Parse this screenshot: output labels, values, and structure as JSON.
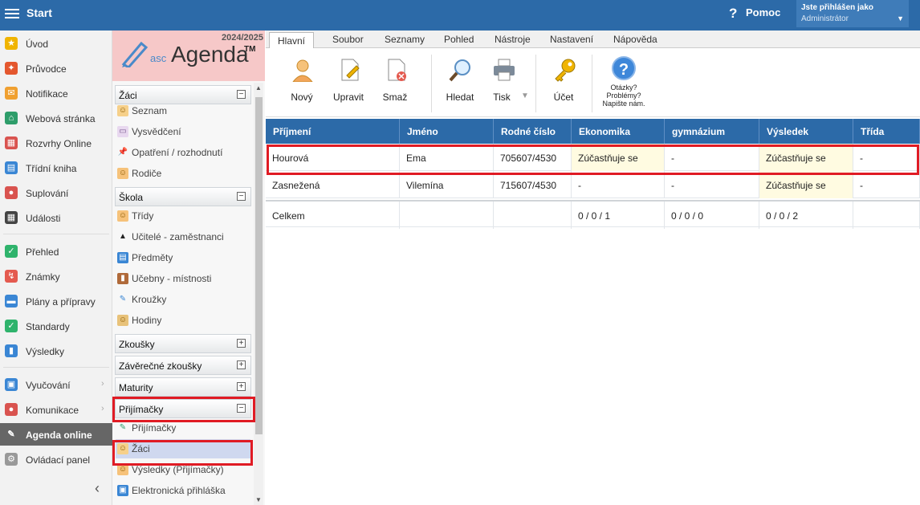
{
  "topbar": {
    "title": "Start",
    "help_label": "Pomoc",
    "user_line1": "Jste přihlášen jako",
    "user_line2": "Administrátor"
  },
  "leftnav": [
    {
      "label": "Úvod",
      "icon": "star-icon",
      "color": "#f0b400",
      "glyph": "★"
    },
    {
      "label": "Průvodce",
      "icon": "wand-icon",
      "color": "#e4572e",
      "glyph": "✦"
    },
    {
      "label": "Notifikace",
      "icon": "envelope-icon",
      "color": "#f0a030",
      "glyph": "✉"
    },
    {
      "label": "Webová stránka",
      "icon": "home-icon",
      "color": "#2e9d6a",
      "glyph": "⌂"
    },
    {
      "label": "Rozvrhy Online",
      "icon": "calendar-grid-icon",
      "color": "#d9534f",
      "glyph": "▦"
    },
    {
      "label": "Třídní kniha",
      "icon": "book-icon",
      "color": "#3a86d4",
      "glyph": "▤"
    },
    {
      "label": "Suplování",
      "icon": "person-swap-icon",
      "color": "#d9534f",
      "glyph": "●"
    },
    {
      "label": "Události",
      "icon": "calendar-icon",
      "color": "#444",
      "glyph": "▦"
    },
    {
      "label": "Přehled",
      "icon": "check-circle-icon",
      "color": "#2fb36c",
      "glyph": "✓"
    },
    {
      "label": "Známky",
      "icon": "grades-icon",
      "color": "#e45a4f",
      "glyph": "↯"
    },
    {
      "label": "Plány a přípravy",
      "icon": "briefcase-icon",
      "color": "#3a86d4",
      "glyph": "▬"
    },
    {
      "label": "Standardy",
      "icon": "shield-icon",
      "color": "#2fb36c",
      "glyph": "✓"
    },
    {
      "label": "Výsledky",
      "icon": "bar-chart-icon",
      "color": "#3a86d4",
      "glyph": "▮"
    },
    {
      "label": "Vyučování",
      "icon": "teaching-icon",
      "color": "#3a86d4",
      "glyph": "▣"
    },
    {
      "label": "Komunikace",
      "icon": "chat-icon",
      "color": "#d9534f",
      "glyph": "●"
    },
    {
      "label": "Agenda online",
      "icon": "pen-icon",
      "color": "#666",
      "glyph": "✎"
    },
    {
      "label": "Ovládací panel",
      "icon": "gear-icon",
      "color": "#999",
      "glyph": "⚙"
    }
  ],
  "logo": {
    "year": "2024/2025",
    "asc": "asc",
    "agenda": "Agenda",
    "tm": "TM"
  },
  "sections": {
    "zaci": "Žáci",
    "skola": "Škola",
    "zkousky": "Zkoušky",
    "zaverecne": "Závěrečné zkoušky",
    "maturity": "Maturity",
    "prijimacky": "Přijímačky"
  },
  "zaci_items": [
    "Seznam",
    "Vysvědčení",
    "Opatření / rozhodnutí",
    "Rodiče"
  ],
  "skola_items": [
    "Třídy",
    "Učitelé - zaměstnanci",
    "Předměty",
    "Učebny - místnosti",
    "Kroužky",
    "Hodiny"
  ],
  "prij_items": [
    "Přijímačky",
    "Žáci",
    "Výsledky (Přijímačky)",
    "Elektronická přihláška"
  ],
  "tabs": [
    "Hlavní",
    "Soubor",
    "Seznamy",
    "Pohled",
    "Nástroje",
    "Nastavení",
    "Nápověda"
  ],
  "ribbon": {
    "novy": "Nový",
    "upravit": "Upravit",
    "smaz": "Smaž",
    "hledat": "Hledat",
    "tisk": "Tisk",
    "ucet": "Účet",
    "q1": "Otázky?",
    "q2": "Problémy?",
    "q3": "Napište nám."
  },
  "table": {
    "columns": [
      "Příjmení",
      "Jméno",
      "Rodné číslo",
      "Ekonomika",
      "gymnázium",
      "Výsledek",
      "Třída"
    ],
    "rows": [
      [
        "Hourová",
        "Ema",
        "705607/4530",
        "Zúčastňuje se",
        "-",
        "Zúčastňuje se",
        "-"
      ],
      [
        "Zasnežená",
        "Vilemína",
        "715607/4530",
        "-",
        "-",
        "Zúčastňuje se",
        "-"
      ]
    ],
    "total": [
      "Celkem",
      "",
      "",
      "0 / 0 / 1",
      "0 / 0 / 0",
      "0 / 0 / 2",
      ""
    ]
  }
}
